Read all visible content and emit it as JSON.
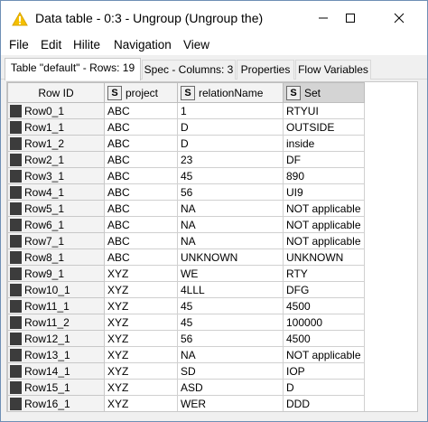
{
  "window": {
    "title": "Data table - 0:3 - Ungroup (Ungroup the)",
    "icon": "warning-triangle-icon",
    "controls": [
      "minimize-icon",
      "maximize-icon",
      "close-icon"
    ]
  },
  "menu": [
    "File",
    "Edit",
    "Hilite",
    "Navigation",
    "View"
  ],
  "tabs": [
    {
      "label": "Table \"default\" - Rows: 19",
      "active": true
    },
    {
      "label": "Spec - Columns: 3",
      "active": false
    },
    {
      "label": "Properties",
      "active": false
    },
    {
      "label": "Flow Variables",
      "active": false
    }
  ],
  "table": {
    "columns": [
      {
        "label": "Row ID",
        "type": ""
      },
      {
        "label": "project",
        "type": "S"
      },
      {
        "label": "relationName",
        "type": "S"
      },
      {
        "label": "Set",
        "type": "S"
      }
    ],
    "rows": [
      [
        "Row0_1",
        "ABC",
        "1",
        "RTYUI"
      ],
      [
        "Row1_1",
        "ABC",
        "D",
        "OUTSIDE"
      ],
      [
        "Row1_2",
        "ABC",
        "D",
        "inside"
      ],
      [
        "Row2_1",
        "ABC",
        "23",
        "DF"
      ],
      [
        "Row3_1",
        "ABC",
        "45",
        "890"
      ],
      [
        "Row4_1",
        "ABC",
        "56",
        "UI9"
      ],
      [
        "Row5_1",
        "ABC",
        "NA",
        "NOT applicable"
      ],
      [
        "Row6_1",
        "ABC",
        "NA",
        "NOT applicable"
      ],
      [
        "Row7_1",
        "ABC",
        "NA",
        "NOT applicable"
      ],
      [
        "Row8_1",
        "ABC",
        "UNKNOWN",
        "UNKNOWN"
      ],
      [
        "Row9_1",
        "XYZ",
        "WE",
        "RTY"
      ],
      [
        "Row10_1",
        "XYZ",
        "4LLL",
        "DFG"
      ],
      [
        "Row11_1",
        "XYZ",
        "45",
        "4500"
      ],
      [
        "Row11_2",
        "XYZ",
        "45",
        "100000"
      ],
      [
        "Row12_1",
        "XYZ",
        "56",
        "4500"
      ],
      [
        "Row13_1",
        "XYZ",
        "NA",
        "NOT applicable"
      ],
      [
        "Row14_1",
        "XYZ",
        "SD",
        "IOP"
      ],
      [
        "Row15_1",
        "XYZ",
        "ASD",
        "D"
      ],
      [
        "Row16_1",
        "XYZ",
        "WER",
        "DDD"
      ]
    ]
  }
}
